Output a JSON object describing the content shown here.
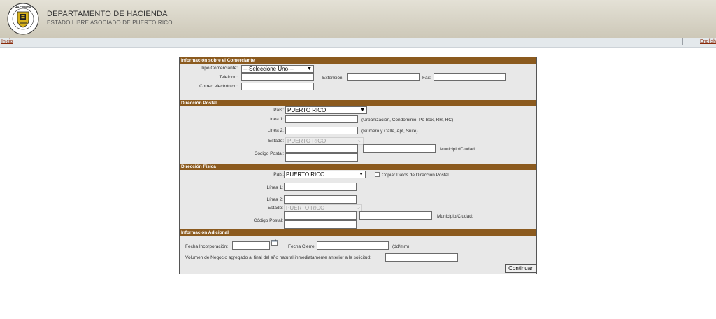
{
  "header": {
    "title": "DEPARTAMENTO DE HACIENDA",
    "subtitle": "ESTADO LIBRE ASOCIADO DE PUERTO RICO",
    "seal_top_text": "HACIENDA"
  },
  "nav": {
    "home": "Inicio",
    "language": "English"
  },
  "merchant": {
    "heading": "Información sobre el Comerciante",
    "type_label": "Tipo Comerciante:",
    "type_value": "---Seleccione Uno---",
    "phone_label": "Telefono:",
    "extension_label": "Extensión:",
    "fax_label": "Fax:",
    "email_label": "Correo electrónico:"
  },
  "postal": {
    "heading": "Dirección Postal",
    "country_label": "País:",
    "country_value": "PUERTO RICO",
    "line1_label": "Línea 1:",
    "line1_hint": "(Urbanización, Condominio, Po Box, RR, HC)",
    "line2_label": "Línea 2:",
    "line2_hint": "(Número y Calle, Apt, Suite)",
    "state_label": "Estado:",
    "state_value": "PUERTO RICO",
    "zip_label": "Código Postal:",
    "city_label": "Municipio/Ciudad:"
  },
  "physical": {
    "heading": "Dirección Física",
    "country_label": "País:",
    "country_value": "PUERTO RICO",
    "copy_label": "Copiar Datos de Dirección Postal",
    "line1_label": "Línea 1:",
    "line2_label": "Línea 2:",
    "state_label": "Estado:",
    "state_value": "PUERTO RICO",
    "zip_label": "Código Postal:",
    "city_label": "Municipio/Ciudad:"
  },
  "additional": {
    "heading": "Información Adicional",
    "incorporation_label": "Fecha Incorporación:",
    "closing_label": "Fecha Cierre:",
    "date_hint": "(dd/mm)",
    "volume_label": "Volumen de Negocio agregado al final del año natural inmediatamente anterior a la solicitud:"
  },
  "actions": {
    "continue": "Continuar"
  },
  "colors": {
    "section_header": "#8b5a1e",
    "link": "#8a2b0b",
    "form_bg": "#e8e8e8"
  }
}
